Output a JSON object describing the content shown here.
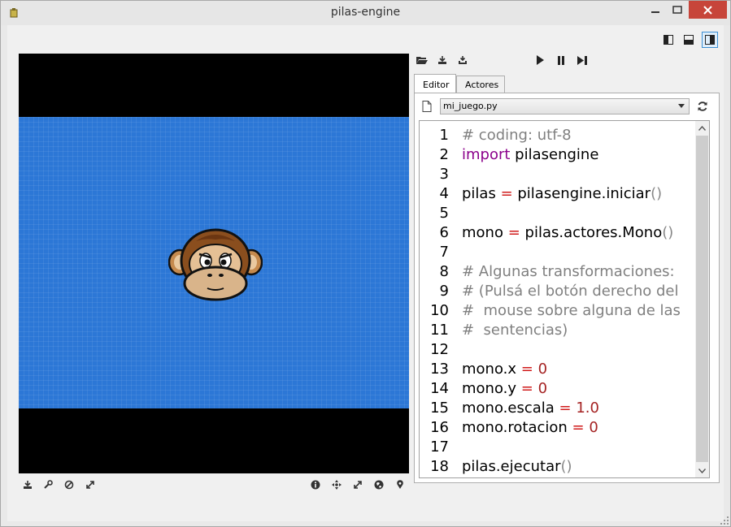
{
  "window": {
    "title": "pilas-engine",
    "icon": "pilas-app-icon"
  },
  "layout_buttons": [
    {
      "name": "layout-left-panel-icon",
      "active": false
    },
    {
      "name": "layout-bottom-panel-icon",
      "active": false
    },
    {
      "name": "layout-right-panel-icon",
      "active": true
    }
  ],
  "editor_toolbar": {
    "left": [
      "folder-open-icon",
      "save-icon",
      "save-as-icon"
    ],
    "right": [
      "play-icon",
      "pause-icon",
      "step-icon"
    ]
  },
  "tabs": [
    {
      "label": "Editor",
      "active": true
    },
    {
      "label": "Actores",
      "active": false
    }
  ],
  "file": {
    "selected": "mi_juego.py"
  },
  "code": [
    {
      "n": "1",
      "parts": [
        {
          "t": "# coding: utf-8",
          "c": "comment"
        }
      ]
    },
    {
      "n": "2",
      "parts": [
        {
          "t": "import",
          "c": "kw"
        },
        {
          "t": " pilasengine",
          "c": ""
        }
      ]
    },
    {
      "n": "3",
      "parts": []
    },
    {
      "n": "4",
      "parts": [
        {
          "t": "pilas ",
          "c": ""
        },
        {
          "t": "=",
          "c": "op"
        },
        {
          "t": " pilasengine.iniciar",
          "c": ""
        },
        {
          "t": "()",
          "c": "paren"
        }
      ]
    },
    {
      "n": "5",
      "parts": []
    },
    {
      "n": "6",
      "parts": [
        {
          "t": "mono ",
          "c": ""
        },
        {
          "t": "=",
          "c": "op"
        },
        {
          "t": " pilas.actores.Mono",
          "c": ""
        },
        {
          "t": "()",
          "c": "paren"
        }
      ]
    },
    {
      "n": "7",
      "parts": []
    },
    {
      "n": "8",
      "parts": [
        {
          "t": "# Algunas transformaciones:",
          "c": "comment"
        }
      ]
    },
    {
      "n": "9",
      "parts": [
        {
          "t": "# (Pulsá el botón derecho del",
          "c": "comment"
        }
      ]
    },
    {
      "n": "10",
      "parts": [
        {
          "t": "#  mouse sobre alguna de las",
          "c": "comment"
        }
      ]
    },
    {
      "n": "11",
      "parts": [
        {
          "t": "#  sentencias)",
          "c": "comment"
        }
      ]
    },
    {
      "n": "12",
      "parts": []
    },
    {
      "n": "13",
      "parts": [
        {
          "t": "mono.x ",
          "c": ""
        },
        {
          "t": "=",
          "c": "op"
        },
        {
          "t": " ",
          "c": ""
        },
        {
          "t": "0",
          "c": "num"
        }
      ]
    },
    {
      "n": "14",
      "parts": [
        {
          "t": "mono.y ",
          "c": ""
        },
        {
          "t": "=",
          "c": "op"
        },
        {
          "t": " ",
          "c": ""
        },
        {
          "t": "0",
          "c": "num"
        }
      ]
    },
    {
      "n": "15",
      "parts": [
        {
          "t": "mono.escala ",
          "c": ""
        },
        {
          "t": "=",
          "c": "op"
        },
        {
          "t": " ",
          "c": ""
        },
        {
          "t": "1.0",
          "c": "num"
        }
      ]
    },
    {
      "n": "16",
      "parts": [
        {
          "t": "mono.rotacion ",
          "c": ""
        },
        {
          "t": "=",
          "c": "op"
        },
        {
          "t": " ",
          "c": ""
        },
        {
          "t": "0",
          "c": "num"
        }
      ]
    },
    {
      "n": "17",
      "parts": []
    },
    {
      "n": "18",
      "parts": [
        {
          "t": "pilas.ejecutar",
          "c": ""
        },
        {
          "t": "()",
          "c": "paren"
        }
      ]
    }
  ],
  "bottom_tools_left": [
    "save-screenshot-icon",
    "wrench-icon",
    "stop-icon",
    "fullscreen-icon"
  ],
  "bottom_tools_right": [
    "info-icon",
    "move-icon",
    "expand-icon",
    "globe-icon",
    "location-pin-icon"
  ],
  "colors": {
    "stage_blue": "#2c77d6",
    "close_red": "#c7453a",
    "comment": "#808080",
    "keyword": "#8b008b",
    "operator": "#d01c1c",
    "number": "#a52323"
  }
}
